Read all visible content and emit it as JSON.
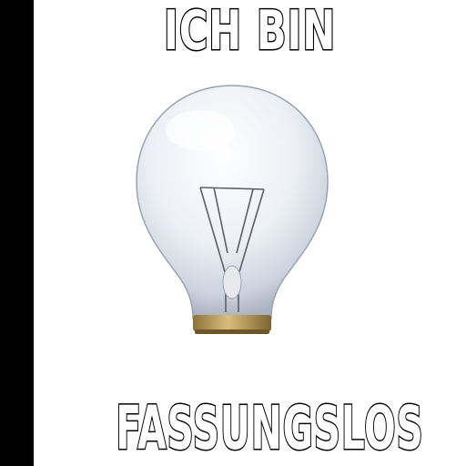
{
  "meme": {
    "top_text": "ICH BIN",
    "bottom_text": "FASSUNGSLOS"
  },
  "colors": {
    "background": "#ffffff",
    "left_bar": "#000000",
    "text_fill": "#ffffff",
    "text_stroke": "#000000",
    "bulb_base": "#b89c5e"
  },
  "icons": {
    "image": "light-bulb-icon"
  }
}
